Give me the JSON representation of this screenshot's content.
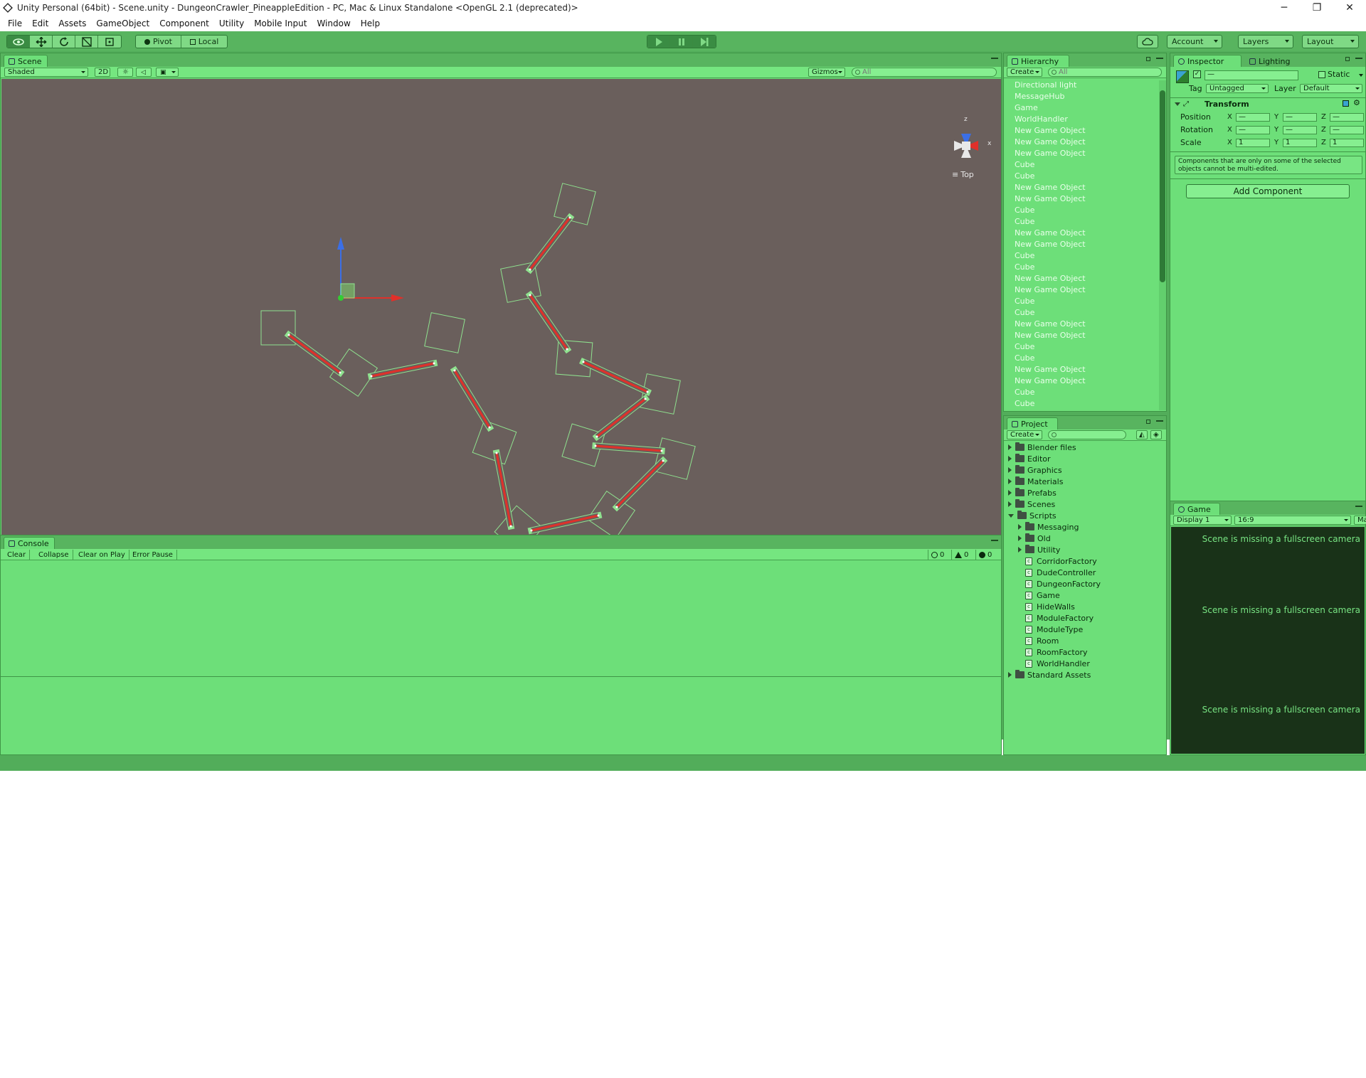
{
  "window": {
    "title": "Unity Personal (64bit) - Scene.unity - DungeonCrawler_PineappleEdition - PC, Mac & Linux Standalone <OpenGL 2.1 (deprecated)>",
    "minimize": "─",
    "restore": "❐",
    "close": "✕"
  },
  "menu": [
    "File",
    "Edit",
    "Assets",
    "GameObject",
    "Component",
    "Utility",
    "Mobile Input",
    "Window",
    "Help"
  ],
  "toolbar": {
    "pivot": "Pivot",
    "local": "Local",
    "account": "Account",
    "layers": "Layers",
    "layout": "Layout"
  },
  "scene": {
    "tab": "Scene",
    "shading": "Shaded",
    "mode_2d": "2D",
    "gizmos": "Gizmos",
    "search_placeholder": "All",
    "gizmo_axis_z": "z",
    "gizmo_axis_x": "x",
    "view_label": "Top"
  },
  "console": {
    "tab": "Console",
    "clear": "Clear",
    "collapse": "Collapse",
    "clear_on_play": "Clear on Play",
    "error_pause": "Error Pause",
    "info_count": "0",
    "warning_count": "0",
    "error_count": "0"
  },
  "hierarchy": {
    "tab": "Hierarchy",
    "create": "Create",
    "search_placeholder": "All",
    "items": [
      "Directional light",
      "MessageHub",
      "Game",
      "WorldHandler",
      "New Game Object",
      "New Game Object",
      "New Game Object",
      "Cube",
      "Cube",
      "New Game Object",
      "New Game Object",
      "Cube",
      "Cube",
      "New Game Object",
      "New Game Object",
      "Cube",
      "Cube",
      "New Game Object",
      "New Game Object",
      "Cube",
      "Cube",
      "New Game Object",
      "New Game Object",
      "Cube",
      "Cube",
      "New Game Object",
      "New Game Object",
      "Cube",
      "Cube"
    ]
  },
  "project": {
    "tab": "Project",
    "create": "Create",
    "folders": [
      "Blender files",
      "Editor",
      "Graphics",
      "Materials",
      "Prefabs",
      "Scenes"
    ],
    "scripts_folder": "Scripts",
    "subfolders": [
      "Messaging",
      "Old",
      "Utility"
    ],
    "scripts": [
      "CorridorFactory",
      "DudeController",
      "DungeonFactory",
      "Game",
      "HideWalls",
      "ModuleFactory",
      "ModuleType",
      "Room",
      "RoomFactory",
      "WorldHandler"
    ],
    "last_folder": "Standard Assets"
  },
  "inspector": {
    "tab": "Inspector",
    "lighting_tab": "Lighting",
    "name_value": "—",
    "static_label": "Static",
    "tag_label": "Tag",
    "tag_value": "Untagged",
    "layer_label": "Layer",
    "layer_value": "Default",
    "transform_label": "Transform",
    "position_label": "Position",
    "rotation_label": "Rotation",
    "scale_label": "Scale",
    "axis_x": "X",
    "axis_y": "Y",
    "axis_z": "Z",
    "dash": "—",
    "scale_x": "1",
    "scale_y": "1",
    "scale_z": "1",
    "multi_edit_note": "Components that are only on some of the selected objects cannot be multi-edited.",
    "add_component": "Add Component"
  },
  "game": {
    "tab": "Game",
    "display": "Display 1",
    "aspect": "16:9",
    "maximize": "Max",
    "messages": [
      "Scene is missing a fullscreen camera",
      "Scene is missing a fullscreen camera",
      "Scene is missing a fullscreen camera"
    ]
  },
  "colors": {
    "editor_bg": "#52ad5a",
    "panel_bg": "#6ddf79",
    "scene_bg": "#6a5f5c",
    "corridor_red": "#e0302a",
    "game_bg": "#193218"
  }
}
